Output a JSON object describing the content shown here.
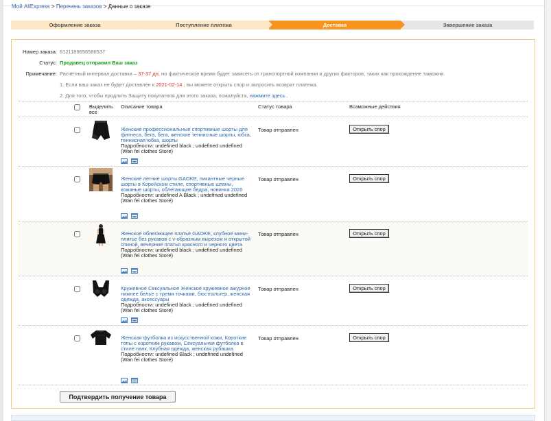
{
  "breadcrumb": {
    "home": "Мой AliExpress",
    "sep1": " > ",
    "orders": "Перечень заказов",
    "sep2": " > ",
    "current": "Данные о заказе"
  },
  "steps": [
    {
      "label": "Оформление заказа",
      "state": "done"
    },
    {
      "label": "Поступление платежа",
      "state": "done"
    },
    {
      "label": "Доставка",
      "state": "active"
    },
    {
      "label": "Завершение заказа",
      "state": "todo"
    }
  ],
  "colors": {
    "step_done": "#fde8c6",
    "step_active": "#f7931e",
    "step_todo": "#e6e6e6",
    "box_border": "#f2c879",
    "link": "#2a67b1",
    "status_green": "#1a9a1a",
    "highlight_red": "#d7302d"
  },
  "order": {
    "number_label": "Номер заказа:",
    "number": "8121189656586537",
    "status_label": "Статус:",
    "status": "Продавец отправил Ваш заказ",
    "note_label": "Примечание:",
    "note_pre": "Расчётный интервал доставки – ",
    "note_days": "37-37 дн",
    "note_post": ", но фактическое время будет зависеть от транспортной компании и других факторов, таких как прохождение таможни.",
    "item1_pre": "1. Если ваш заказ не будет доставлен к ",
    "item1_date": "2021-02-14",
    "item1_post": " , вы можете открыть спор и запросить возврат платежа.",
    "item2_pre": "2. Для того, чтобы продлить Защиту покупателя для этого заказа, пожалуйста, ",
    "item2_link": "нажмите здесь",
    "item2_post": " ."
  },
  "table": {
    "col_select": "Выделить все",
    "col_desc": "Описание товара",
    "col_status": "Статус товара",
    "col_actions": "Возможные действия"
  },
  "products": [
    {
      "title": "Женские профессиональные спортивные шорты для фитнеса, бега, бега, женские теннисные шорты, юбка, теннисная юбка, шорты",
      "details": "Подробности: undefined black ; undefined undefined",
      "store": "(Wan fei clothes Store)",
      "status": "Товар отправлен",
      "action": "Открыть спор",
      "image": "black-sport-skirt"
    },
    {
      "title": "Женские летние шорты GAOKE, пикантные черные шорты в Корейском стиле, спортивные штаны, кожаные шорты, облегающие бедра, новинка 2020",
      "details": "Подробности: undefined A Black ; undefined undefined",
      "store": "(Wan fei clothes Store)",
      "status": "Товар отправлен",
      "action": "Открыть спор",
      "image": "black-leather-shorts"
    },
    {
      "title": "Женское облегающее платье GAOKE, клубное мини-платье без рукавов с v-образным вырезом и открытой спиной, вечерние платья красного и черного цвета",
      "details": "Подробности: undefined black ; undefined undefined",
      "store": "(Wan fei clothes Store)",
      "status": "Товар отправлен",
      "action": "Открыть спор",
      "image": "black-mini-dress"
    },
    {
      "title": "Кружевное Сексуальное Женское кружевное ажурное нижнее белье с тремя точками, бюстгальтер, женская одежда, аксессуары",
      "details": "Подробности: undefined black ; undefined undefined",
      "store": "(Wan fei clothes Store)",
      "status": "Товар отправлен",
      "action": "Открыть спор",
      "image": "black-lace-bra"
    },
    {
      "title": "Женская футболка из искусственной кожи, Короткие топы с коротким рукавом, Сексуальная футболка в стиле панк, Клубная одежда, женская рубашка",
      "details": "Подробности: undefined Black ; undefined undefined",
      "store": "(Wan fei clothes Store)",
      "status": "Товар отправлен",
      "action": "Открыть спор",
      "image": "black-crop-top"
    }
  ],
  "confirm_button": "Подтвердить получение товара"
}
